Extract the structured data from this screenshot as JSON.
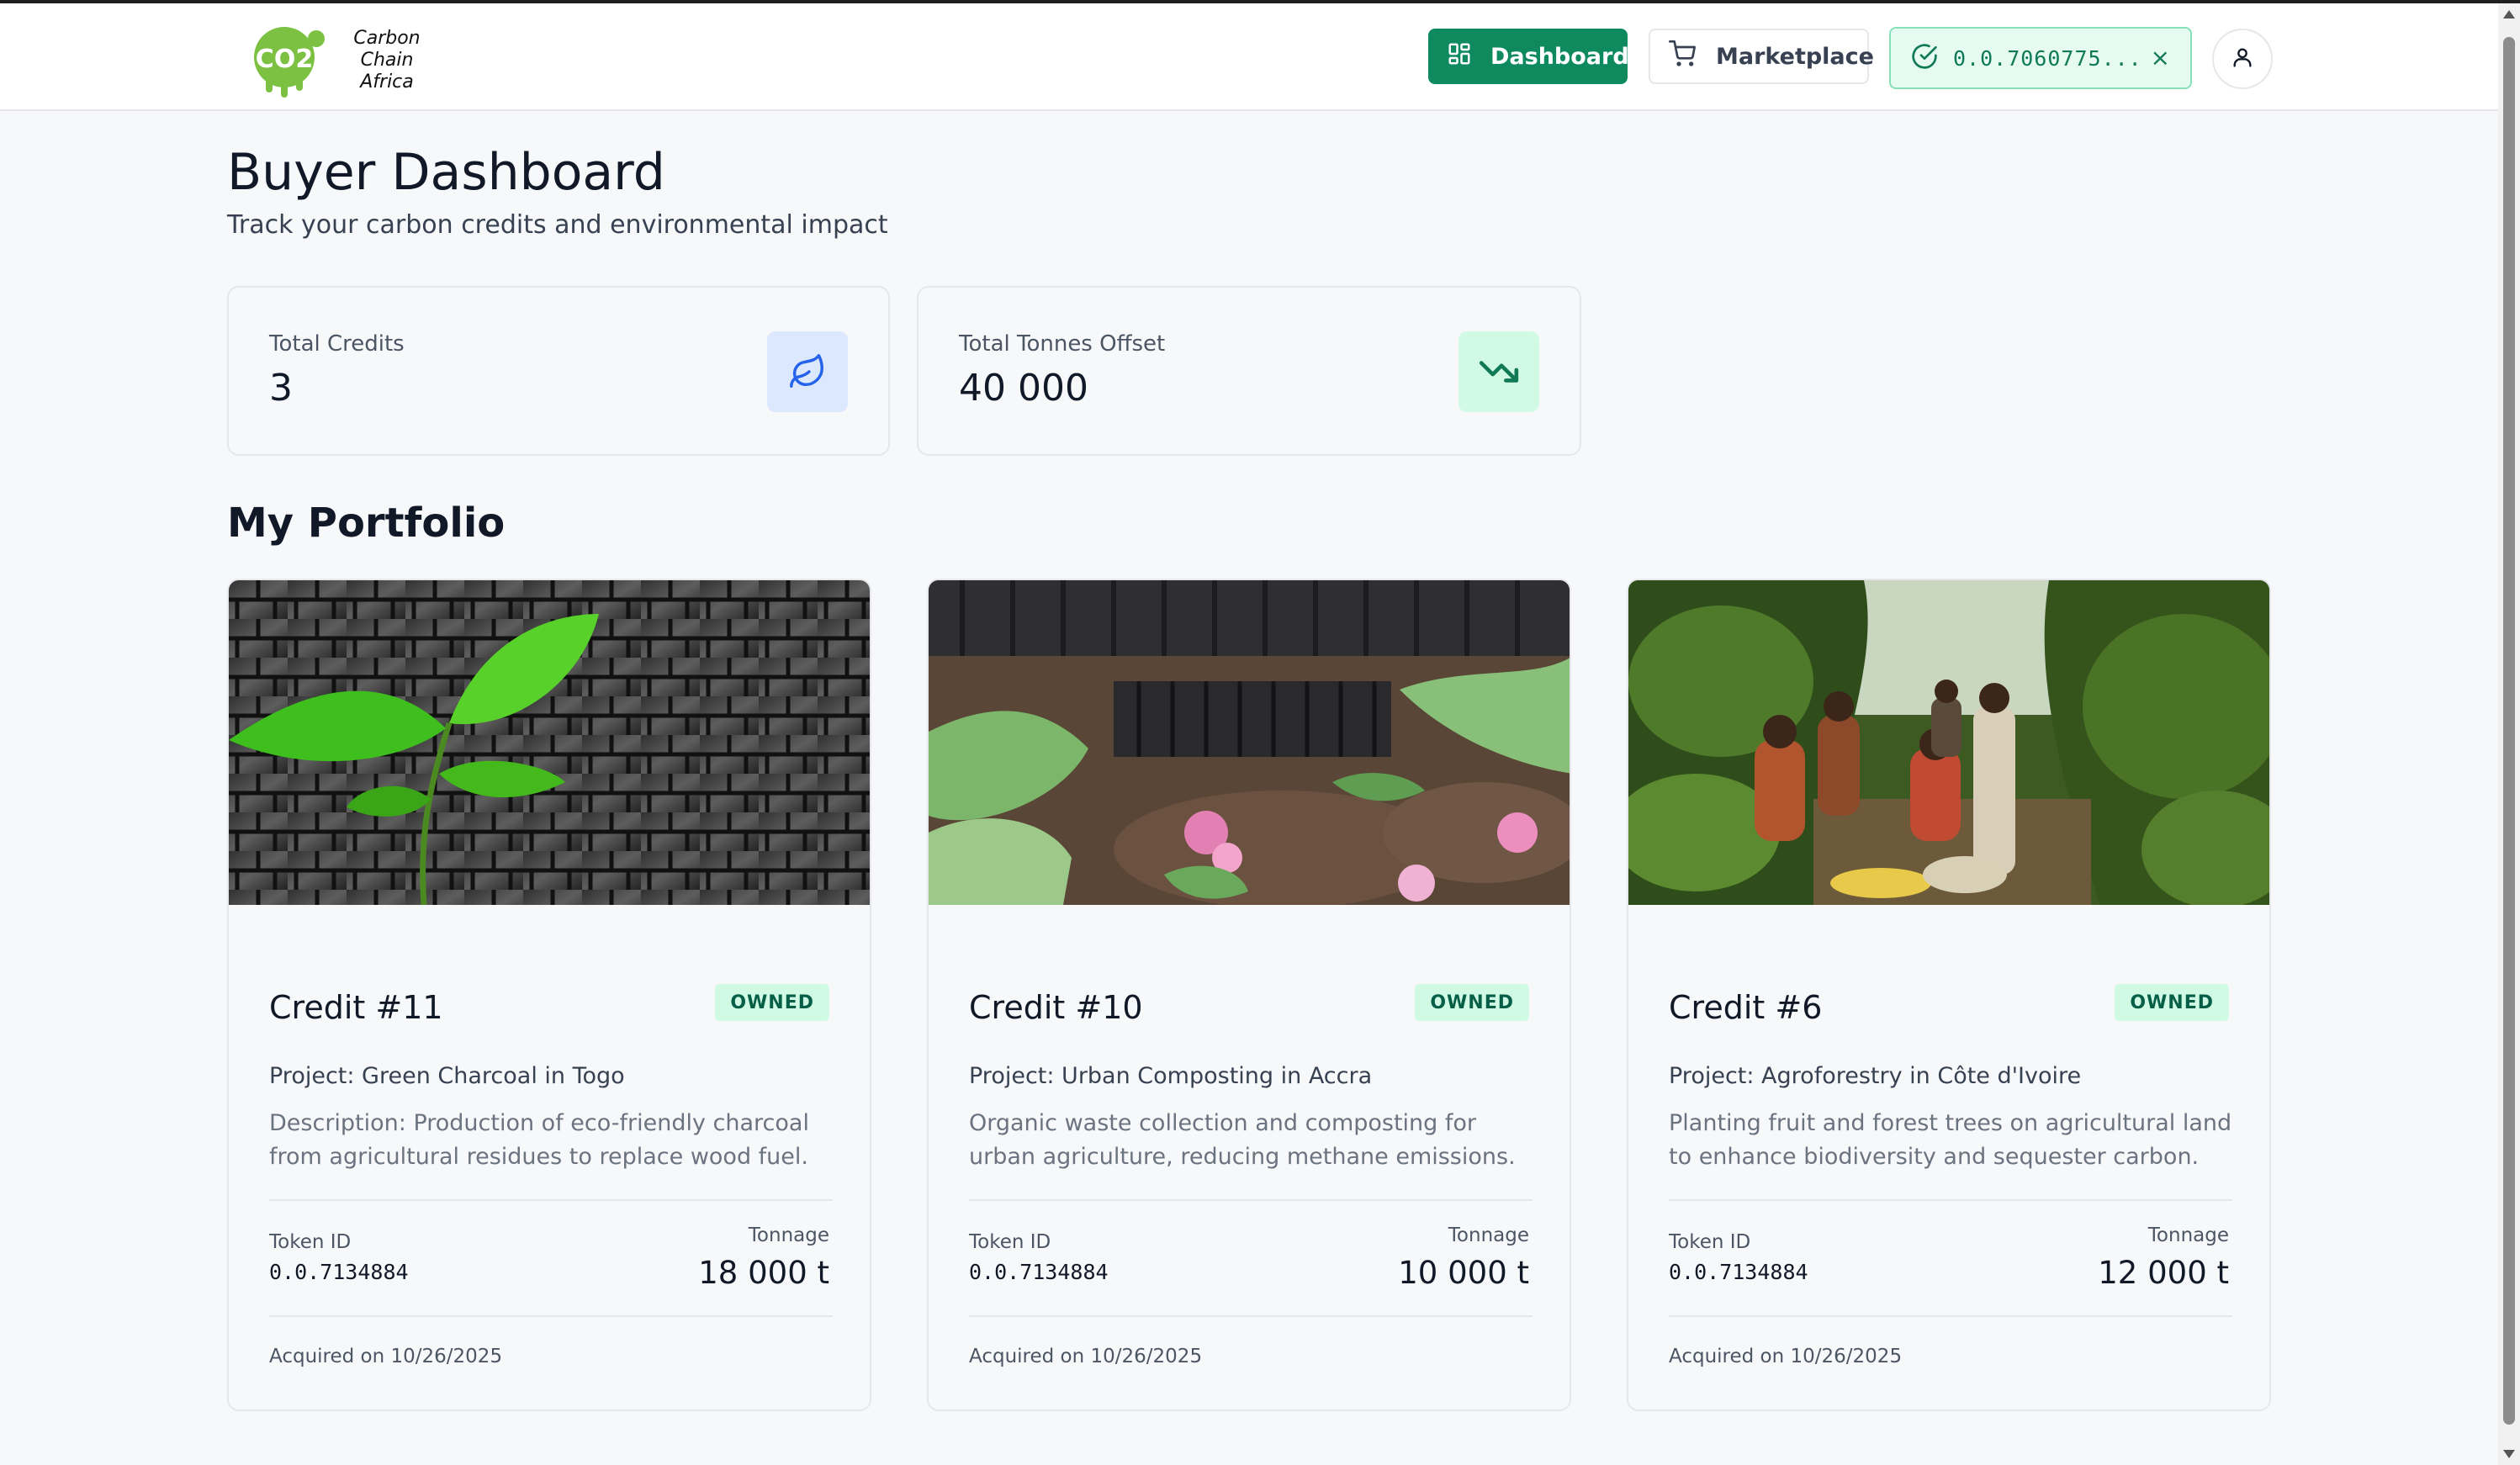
{
  "header": {
    "logo_text_line1": "Carbon Chain",
    "logo_text_line2": "Africa",
    "logo_badge": "CO2",
    "nav": {
      "dashboard_label": "Dashboard",
      "marketplace_label": "Marketplace"
    },
    "wallet": {
      "address": "0.0.7060775...",
      "close_symbol": "×"
    }
  },
  "page": {
    "title": "Buyer Dashboard",
    "subtitle": "Track your carbon credits and environmental impact"
  },
  "stats": [
    {
      "label": "Total Credits",
      "value": "3",
      "icon": "leaf-icon"
    },
    {
      "label": "Total Tonnes Offset",
      "value": "40 000",
      "icon": "trending-down-icon"
    }
  ],
  "portfolio": {
    "title": "My Portfolio",
    "token_label": "Token ID",
    "tonnage_label": "Tonnage",
    "cards": [
      {
        "title": "Credit #11",
        "badge": "OWNED",
        "project": "Project: Green Charcoal in Togo",
        "description": "Description: Production of eco-friendly charcoal from agricultural residues to replace wood fuel.",
        "token_id": "0.0.7134884",
        "tonnage": "18 000 t",
        "acquired": "Acquired on 10/26/2025",
        "image": "seedling-on-charcoal"
      },
      {
        "title": "Credit #10",
        "badge": "OWNED",
        "project": "Project: Urban Composting in Accra",
        "description": "Organic waste collection and composting for urban agriculture, reducing methane emissions.",
        "token_id": "0.0.7134884",
        "tonnage": "10 000 t",
        "acquired": "Acquired on 10/26/2025",
        "image": "compost-crates"
      },
      {
        "title": "Credit #6",
        "badge": "OWNED",
        "project": "Project: Agroforestry in Côte d'Ivoire",
        "description": "Planting fruit and forest trees on agricultural land to enhance biodiversity and sequester carbon.",
        "token_id": "0.0.7134884",
        "tonnage": "12 000 t",
        "acquired": "Acquired on 10/26/2025",
        "image": "farmers-in-forest"
      }
    ]
  },
  "colors": {
    "primary": "#0f8a5f",
    "badge_bg": "#d1fae5",
    "badge_text": "#065f46",
    "wallet_bg": "#e6faf1",
    "credits_icon_bg": "#dbe8fe"
  }
}
